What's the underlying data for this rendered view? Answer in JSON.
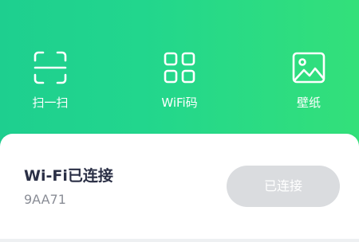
{
  "colors": {
    "gradient_start": "#1ecf8f",
    "gradient_end": "#33e07a",
    "title": "#2a2f45",
    "subtitle": "#8a8d96",
    "button_bg": "#dadcdf"
  },
  "actions": [
    {
      "label": "扫一扫",
      "icon": "scan-icon"
    },
    {
      "label": "WiFi码",
      "icon": "qr-code-icon"
    },
    {
      "label": "壁纸",
      "icon": "wallpaper-image-icon"
    }
  ],
  "card": {
    "title": "Wi-Fi已连接",
    "subtitle": "9AA71",
    "button_label": "已连接"
  }
}
